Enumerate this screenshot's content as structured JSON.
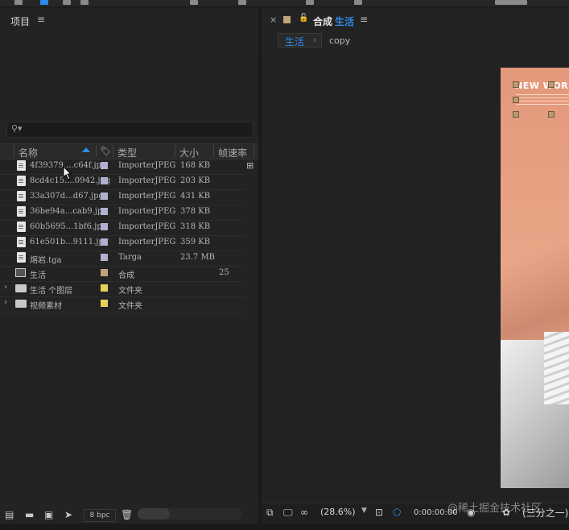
{
  "project_panel": {
    "title": "项目",
    "menu_icon": "hamburger-icon",
    "search_icon": "search-icon",
    "columns": {
      "name": "名称",
      "label_icon": "tag-icon",
      "type": "类型",
      "size": "大小",
      "fps": "帧速率"
    },
    "items": [
      {
        "name": "4f39379....c64f.jpg",
        "type": "ImporterJPEG",
        "size": "168 KB",
        "fps": "",
        "label_color": "#b0b0d0",
        "icon": "image-file-icon"
      },
      {
        "name": "8cd4c15....0942.jpg",
        "type": "ImporterJPEG",
        "size": "203 KB",
        "fps": "",
        "label_color": "#b0b0d0",
        "icon": "image-file-icon"
      },
      {
        "name": "33a307d...d67.jpg",
        "type": "ImporterJPEG",
        "size": "431 KB",
        "fps": "",
        "label_color": "#b0b0d0",
        "icon": "image-file-icon"
      },
      {
        "name": "36be94a...cab9.jpg",
        "type": "ImporterJPEG",
        "size": "378 KB",
        "fps": "",
        "label_color": "#b0b0d0",
        "icon": "image-file-icon"
      },
      {
        "name": "60b5695...1bf6.jpg",
        "type": "ImporterJPEG",
        "size": "318 KB",
        "fps": "",
        "label_color": "#b0b0d0",
        "icon": "image-file-icon"
      },
      {
        "name": "61e501b...9111.jpg",
        "type": "ImporterJPEG",
        "size": "359 KB",
        "fps": "",
        "label_color": "#b0b0d0",
        "icon": "image-file-icon"
      },
      {
        "name": "熔岩.tga",
        "type": "Targa",
        "size": "23.7 MB",
        "fps": "",
        "label_color": "#b0b0d0",
        "icon": "image-file-icon"
      },
      {
        "name": "生活",
        "type": "合成",
        "size": "",
        "fps": "25",
        "label_color": "#c2a47a",
        "icon": "composition-icon"
      },
      {
        "name": "生活 个图层",
        "type": "文件夹",
        "size": "",
        "fps": "",
        "label_color": "#e6d25a",
        "icon": "folder-icon"
      },
      {
        "name": "视频素材",
        "type": "文件夹",
        "size": "",
        "fps": "",
        "label_color": "#e6d25a",
        "icon": "folder-icon"
      }
    ],
    "footer": {
      "bpc": "8 bpc",
      "icons": [
        "interpret-footage-icon",
        "new-folder-icon",
        "new-composition-icon",
        "render-queue-icon",
        "trash-icon"
      ]
    }
  },
  "composition_panel": {
    "tab_prefix": "合成",
    "tab_name": "生活",
    "breadcrumb_active": "生活",
    "breadcrumb_other": "copy",
    "canvas_title": "NEW WORLD",
    "zoom": "(28.6%)",
    "timecode": "0:00:00:00",
    "resolution": "(三分之一)",
    "icons": [
      "close-icon",
      "lock-icon",
      "hamburger-icon",
      "region-of-interest-icon",
      "snapshot-icon",
      "show-channel-icon"
    ]
  },
  "watermark": "@稀土掘金技术社区",
  "colors": {
    "accent": "#2d8ceb",
    "panel_bg": "#232323",
    "canvas_top": "#e4987a"
  }
}
